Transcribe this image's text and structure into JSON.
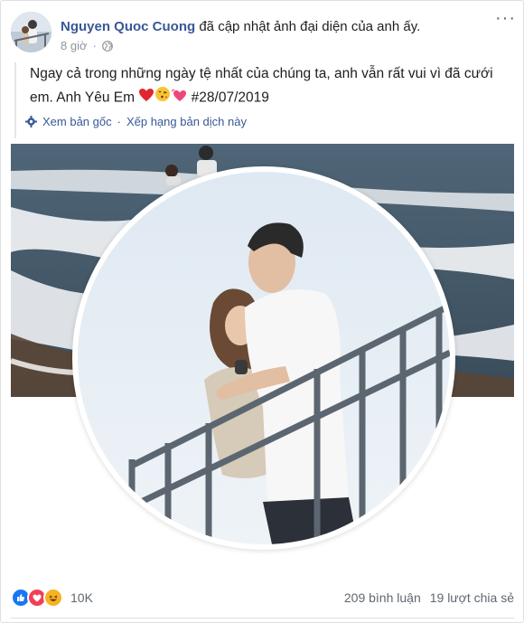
{
  "post": {
    "author": "Nguyen Quoc Cuong",
    "action": "đã cập nhật ảnh đại diện của anh ấy.",
    "time": "8 giờ",
    "privacy_icon": "globe-icon",
    "more_icon": "more-options-icon",
    "caption_text": "Ngay cả trong những ngày tệ nhất của chúng ta, anh vẫn rất vui vì đã cưới em. Anh Yêu Em",
    "caption_tag": "#28/07/2019",
    "emojis": [
      "red-heart",
      "face-blowing-kiss",
      "growing-heart"
    ],
    "translate": {
      "icon": "gear-icon",
      "see_original": "Xem bản gốc",
      "separator": "·",
      "rate_translation": "Xếp hạng bản dịch này"
    }
  },
  "footer": {
    "reactions": [
      "like",
      "love",
      "haha"
    ],
    "reaction_count": "10K",
    "comments": "209 bình luận",
    "shares": "19 lượt chia sẻ"
  },
  "colors": {
    "link": "#385898",
    "meta": "#90949c",
    "like": "#1877f2",
    "love": "#f33e58",
    "haha": "#f7b125"
  }
}
